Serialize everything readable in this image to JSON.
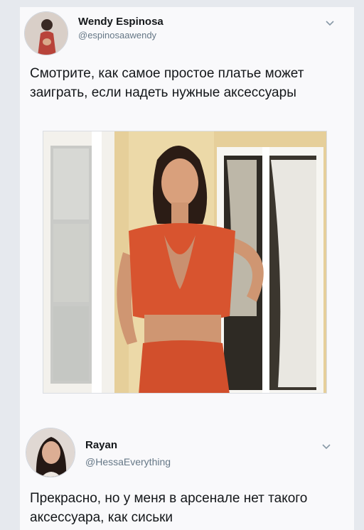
{
  "tweets": [
    {
      "author_name": "Wendy Espinosa",
      "author_handle": "@espinosaawendy",
      "text": "Смотрите, как самое простое платье может заиграть, если надеть нужные аксессуары",
      "has_photo": true
    },
    {
      "author_name": "Rayan",
      "author_handle": "@HessaEverything",
      "text": "Прекрасно, но у меня в арсенале нет такого аксессуара, как сиськи",
      "has_photo": false
    }
  ],
  "icons": {
    "menu": "chevron-down-icon",
    "avatar": "avatar-icon"
  },
  "colors": {
    "background": "#e6e9ee",
    "card": "#f9f9fb",
    "text": "#14171a",
    "secondary_text": "#657786",
    "dress": "#d8542f"
  }
}
